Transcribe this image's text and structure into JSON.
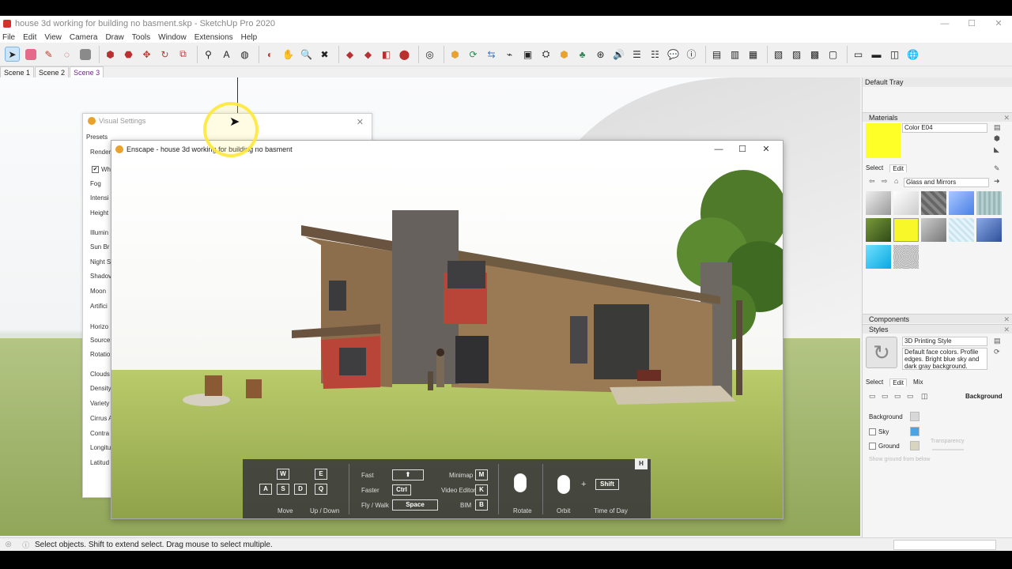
{
  "window": {
    "title": "house 3d working for building no basment.skp - SketchUp Pro 2020",
    "minimize": "—",
    "maximize": "☐",
    "close": "✕"
  },
  "menu": [
    "File",
    "Edit",
    "View",
    "Camera",
    "Draw",
    "Tools",
    "Window",
    "Extensions",
    "Help"
  ],
  "scenes": [
    "Scene 1",
    "Scene 2",
    "Scene 3"
  ],
  "active_scene": "Scene 3",
  "visual_settings": {
    "title": "Visual Settings",
    "presets_label": "Presets",
    "items": [
      "Render",
      "Wh",
      "Fog",
      "Intensi",
      "Height",
      "Illumin",
      "Sun Br",
      "Night S",
      "Shadov",
      "Moon",
      "Artifici",
      "Horizo",
      "Source",
      "Rotatio",
      "Clouds",
      "Density",
      "Variety",
      "Cirrus A",
      "Contra",
      "Longitu",
      "Latitud"
    ]
  },
  "enscape": {
    "title": "Enscape - house 3d working for building no basment",
    "controls": {
      "keys_move": [
        "W",
        "A",
        "S",
        "D"
      ],
      "keys_updown": [
        "E",
        "Q"
      ],
      "move_label": "Move",
      "updown_label": "Up / Down",
      "fast_label": "Fast",
      "fast_key": "⬆",
      "faster_label": "Faster",
      "faster_key": "Ctrl",
      "flywalk_label": "Fly / Walk",
      "flywalk_key": "Space",
      "minimap_label": "Minimap",
      "minimap_key": "M",
      "video_label": "Video Editor",
      "video_key": "K",
      "bim_label": "BIM",
      "bim_key": "B",
      "rotate_label": "Rotate",
      "orbit_label": "Orbit",
      "time_label": "Time of Day",
      "shift_key": "Shift",
      "plus": "+",
      "help_key": "H"
    }
  },
  "tray": {
    "title": "Default Tray",
    "materials": {
      "heading": "Materials",
      "name": "Color E04",
      "tabs": [
        "Select",
        "Edit"
      ],
      "collection": "Glass and Mirrors",
      "swatch_color": "#ffff28",
      "swatches": [
        "#bdbdbd",
        "#e8e8e8",
        "#7a7f83",
        "#6f9ff0",
        "#a8c4c4",
        "#4a6b2a",
        "#f7f72a",
        "#9c9c9c",
        "#d6eaf2",
        "#5f83c4",
        "#2fc3ee",
        "#cfcfcf"
      ]
    },
    "components": {
      "heading": "Components"
    },
    "styles": {
      "heading": "Styles",
      "name": "3D Printing Style",
      "description": "Default face colors. Profile edges. Bright blue sky and dark gray background.",
      "tabs": [
        "Select",
        "Edit",
        "Mix"
      ],
      "section": "Background",
      "rows": [
        {
          "label": "Background",
          "color": "#d8d8d8"
        },
        {
          "label": "Sky",
          "color": "#4aa3e2"
        },
        {
          "label": "Ground",
          "color": "#d8d4c0"
        }
      ],
      "transparency": "Transparency",
      "show_ground": "Show ground from below"
    }
  },
  "status": {
    "text": "Select objects. Shift to extend select. Drag mouse to select multiple."
  }
}
